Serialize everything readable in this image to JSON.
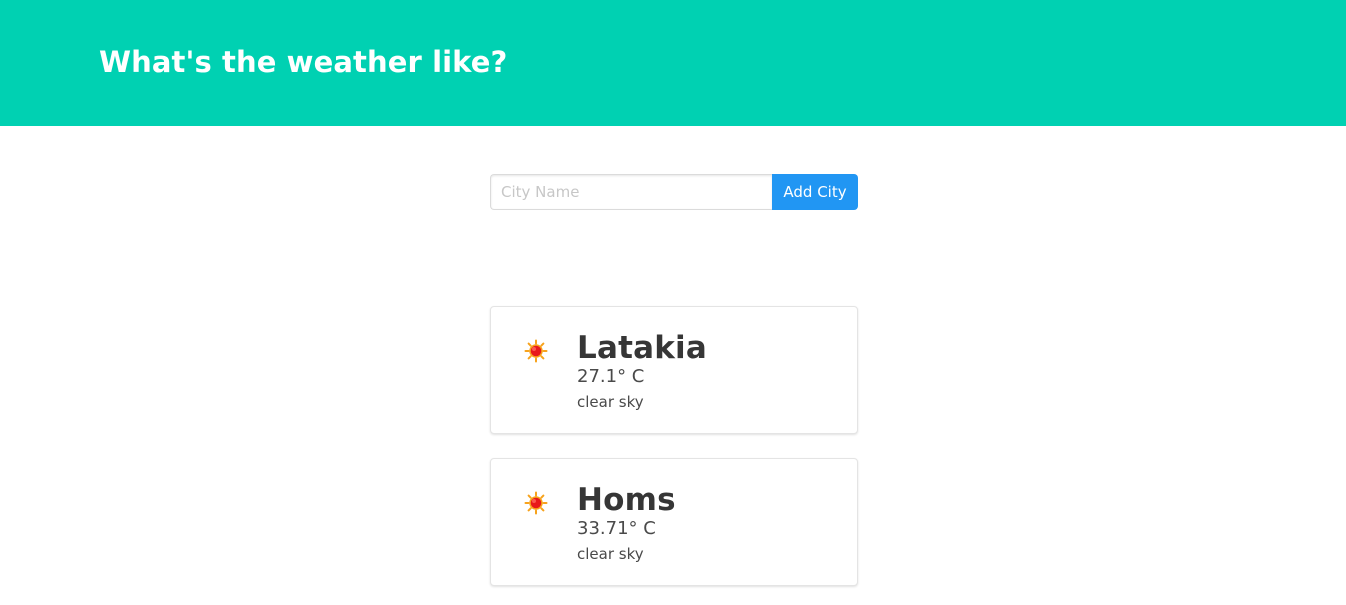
{
  "header": {
    "title": "What's the weather like?",
    "background_color": "#00d1b2"
  },
  "form": {
    "placeholder": "City Name",
    "value": "",
    "button_label": "Add City",
    "button_color": "#2196f3"
  },
  "cities": [
    {
      "name": "Latakia",
      "temperature": "27.1° C",
      "description": "clear sky",
      "icon": "sun-icon"
    },
    {
      "name": "Homs",
      "temperature": "33.71° C",
      "description": "clear sky",
      "icon": "sun-icon"
    }
  ]
}
